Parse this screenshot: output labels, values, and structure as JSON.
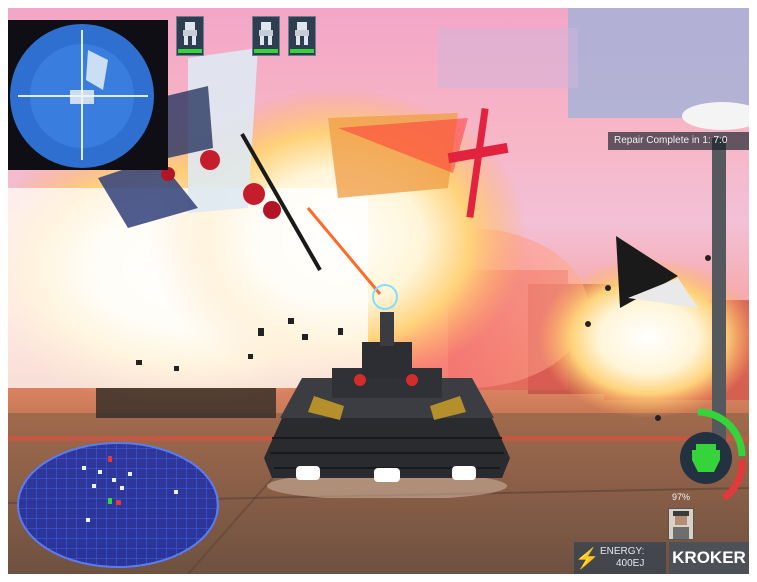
{
  "hud": {
    "repair_status": "Repair Complete in 1: 7:0",
    "energy_label": "ENERGY:",
    "energy_value": "400EJ",
    "player_name": "KROKER",
    "armor_percent": "97%",
    "energy_icon": "lightning-bolt-icon",
    "ally_icons": [
      "mech-icon",
      "mech-icon",
      "mech-icon"
    ],
    "armor_level": 0.97,
    "accent_green": "#35d43a",
    "accent_red": "#e23a3a"
  }
}
